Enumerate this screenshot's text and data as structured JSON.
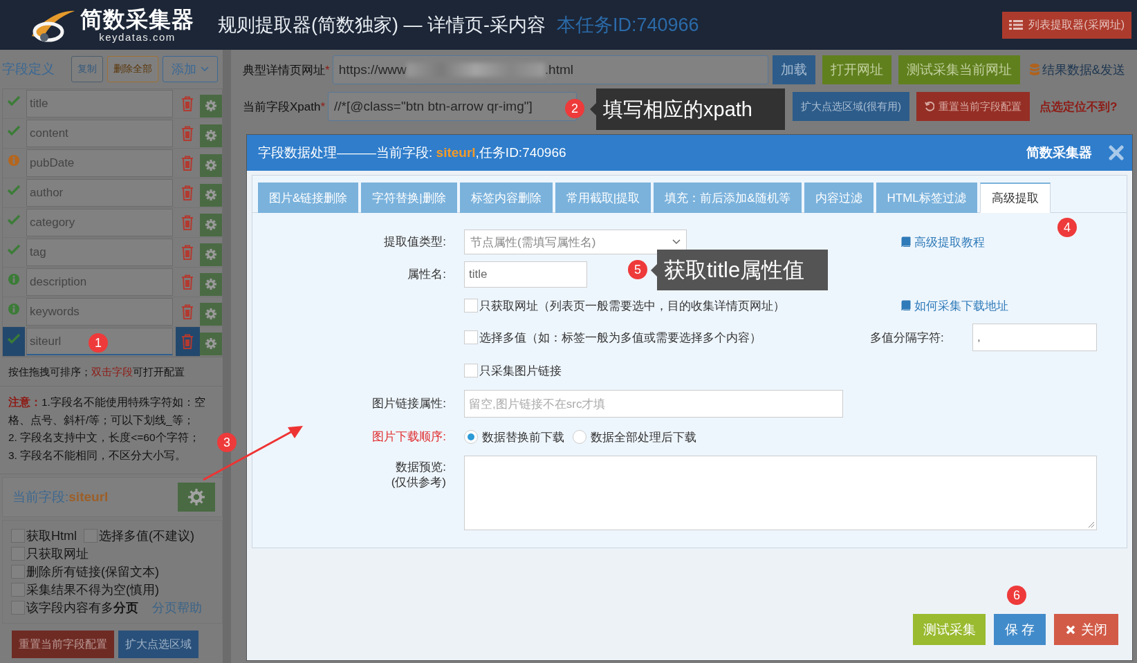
{
  "header": {
    "logo_name": "简数采集器",
    "logo_domain": "keydatas.com",
    "title": "规则提取器(简数独家) — 详情页-采内容",
    "task_id": "本任务ID:740966",
    "list_button": "列表提取器(采网址)"
  },
  "sidebar": {
    "heading": "字段定义",
    "buttons": [
      {
        "label": "复制",
        "kind": "copy"
      },
      {
        "label": "删除全部",
        "kind": "delete"
      },
      {
        "label": "添加",
        "kind": "add"
      }
    ],
    "fields": [
      {
        "name": "title",
        "kind": "ok",
        "selected": false
      },
      {
        "name": "content",
        "kind": "ok",
        "selected": false
      },
      {
        "name": "pubDate",
        "kind": "warn",
        "selected": false
      },
      {
        "name": "author",
        "kind": "ok",
        "selected": false
      },
      {
        "name": "category",
        "kind": "ok",
        "selected": false
      },
      {
        "name": "tag",
        "kind": "ok",
        "selected": false
      },
      {
        "name": "description",
        "kind": "info",
        "selected": false
      },
      {
        "name": "keywords",
        "kind": "info",
        "selected": false
      },
      {
        "name": "siteurl",
        "kind": "ok",
        "selected": true
      }
    ],
    "hint": "按住拖拽可排序；**双击字段**可打开配置",
    "notes": [
      "**注意：**1.字段名不能使用特殊字符如：空格、点号、斜杆/等；可以下划线_等；",
      "2. 字段名支持中文，长度<=60个字符；",
      "3. 字段名不能相同，不区分大小写。"
    ],
    "current_field": {
      "label": "当前字段:",
      "name": "siteurl"
    },
    "options": [
      {
        "label": "获取Html",
        "checked": false
      },
      {
        "label": "选择多值(不建议)",
        "checked": false
      },
      {
        "label": "只获取网址",
        "checked": false
      },
      {
        "label": "删除所有链接(保留文本)",
        "checked": false
      },
      {
        "label": "采集结果不得为空(慎用)",
        "checked": false
      },
      {
        "label": "该字段内容有多**分页**",
        "checked": false,
        "help_link": "分页帮助"
      }
    ],
    "bottom_buttons": [
      {
        "label": "重置当前字段配置",
        "kind": "danger"
      },
      {
        "label": "扩大点选区域",
        "kind": "primary"
      }
    ]
  },
  "toolbar": {
    "url_label": "典型详情页网址",
    "url_mark": "*",
    "url_start": "https://www",
    "url_end": ".html",
    "buttons": [
      {
        "label": "加载",
        "kind": "primary"
      },
      {
        "label": "打开网址",
        "kind": "success"
      },
      {
        "label": "测试采集当前网址",
        "kind": "success"
      }
    ],
    "results_link": "结果数据&发送",
    "xpath_label": "当前字段Xpath",
    "xpath_mark": "*",
    "xpath_value": "//*[@class=\"btn btn-arrow qr-img\"]",
    "buttons2": [
      {
        "label": "扩大点选区域(很有用)",
        "kind": "primary"
      },
      {
        "label": "重置当前字段配置",
        "kind": "danger"
      }
    ],
    "locate_help": "点选定位不到?"
  },
  "modal": {
    "title_prefix": "字段数据处理———当前字段: ",
    "field": "siteurl",
    "title_suffix": ",任务ID:740966",
    "brand": "简数采集器",
    "tabs": [
      {
        "label": "图片&链接删除",
        "selected": false
      },
      {
        "label": "字符替换|删除",
        "selected": false
      },
      {
        "label": "标签内容删除",
        "selected": false
      },
      {
        "label": "常用截取|提取",
        "selected": false
      },
      {
        "label": "填充：前后添加&随机等",
        "selected": false
      },
      {
        "label": "内容过滤",
        "selected": false
      },
      {
        "label": "HTML标签过滤",
        "selected": false
      },
      {
        "label": "高级提取",
        "selected": true
      }
    ],
    "type_label": "提取值类型:",
    "type_value": "节点属性(需填写属性名)",
    "tutorial_link": "高级提取教程",
    "attr_label": "属性名:",
    "attr_value": "title",
    "checks": [
      {
        "label": "只获取网址（列表页一般需要选中，目的收集详情页网址）",
        "checked": false
      },
      {
        "label": "选择多值（如：标签一般为多值或需要选择多个内容）",
        "checked": false
      },
      {
        "label": "只采集图片链接",
        "checked": false
      }
    ],
    "download_link": "如何采集下载地址",
    "separator_label": "多值分隔字符:",
    "separator_value": ",",
    "img_attr_label": "图片链接属性:",
    "img_attr_placeholder": "留空,图片链接不在src才填",
    "order_label": "图片下载顺序:",
    "order_options": [
      {
        "label": "数据替换前下载",
        "selected": true
      },
      {
        "label": "数据全部处理后下载",
        "selected": false
      }
    ],
    "preview_label": [
      "数据预览:",
      "(仅供参考)"
    ],
    "footer_buttons": [
      {
        "label": "测试采集",
        "kind": "test"
      },
      {
        "label": "保 存",
        "kind": "save"
      },
      {
        "label": "关闭",
        "kind": "close"
      }
    ]
  },
  "annotations": [
    {
      "number": "1"
    },
    {
      "number": "2"
    },
    {
      "number": "3"
    },
    {
      "number": "4"
    },
    {
      "number": "5"
    },
    {
      "number": "6"
    }
  ],
  "callouts": [
    {
      "text": "填写相应的xpath"
    },
    {
      "text": "获取title属性值"
    }
  ]
}
